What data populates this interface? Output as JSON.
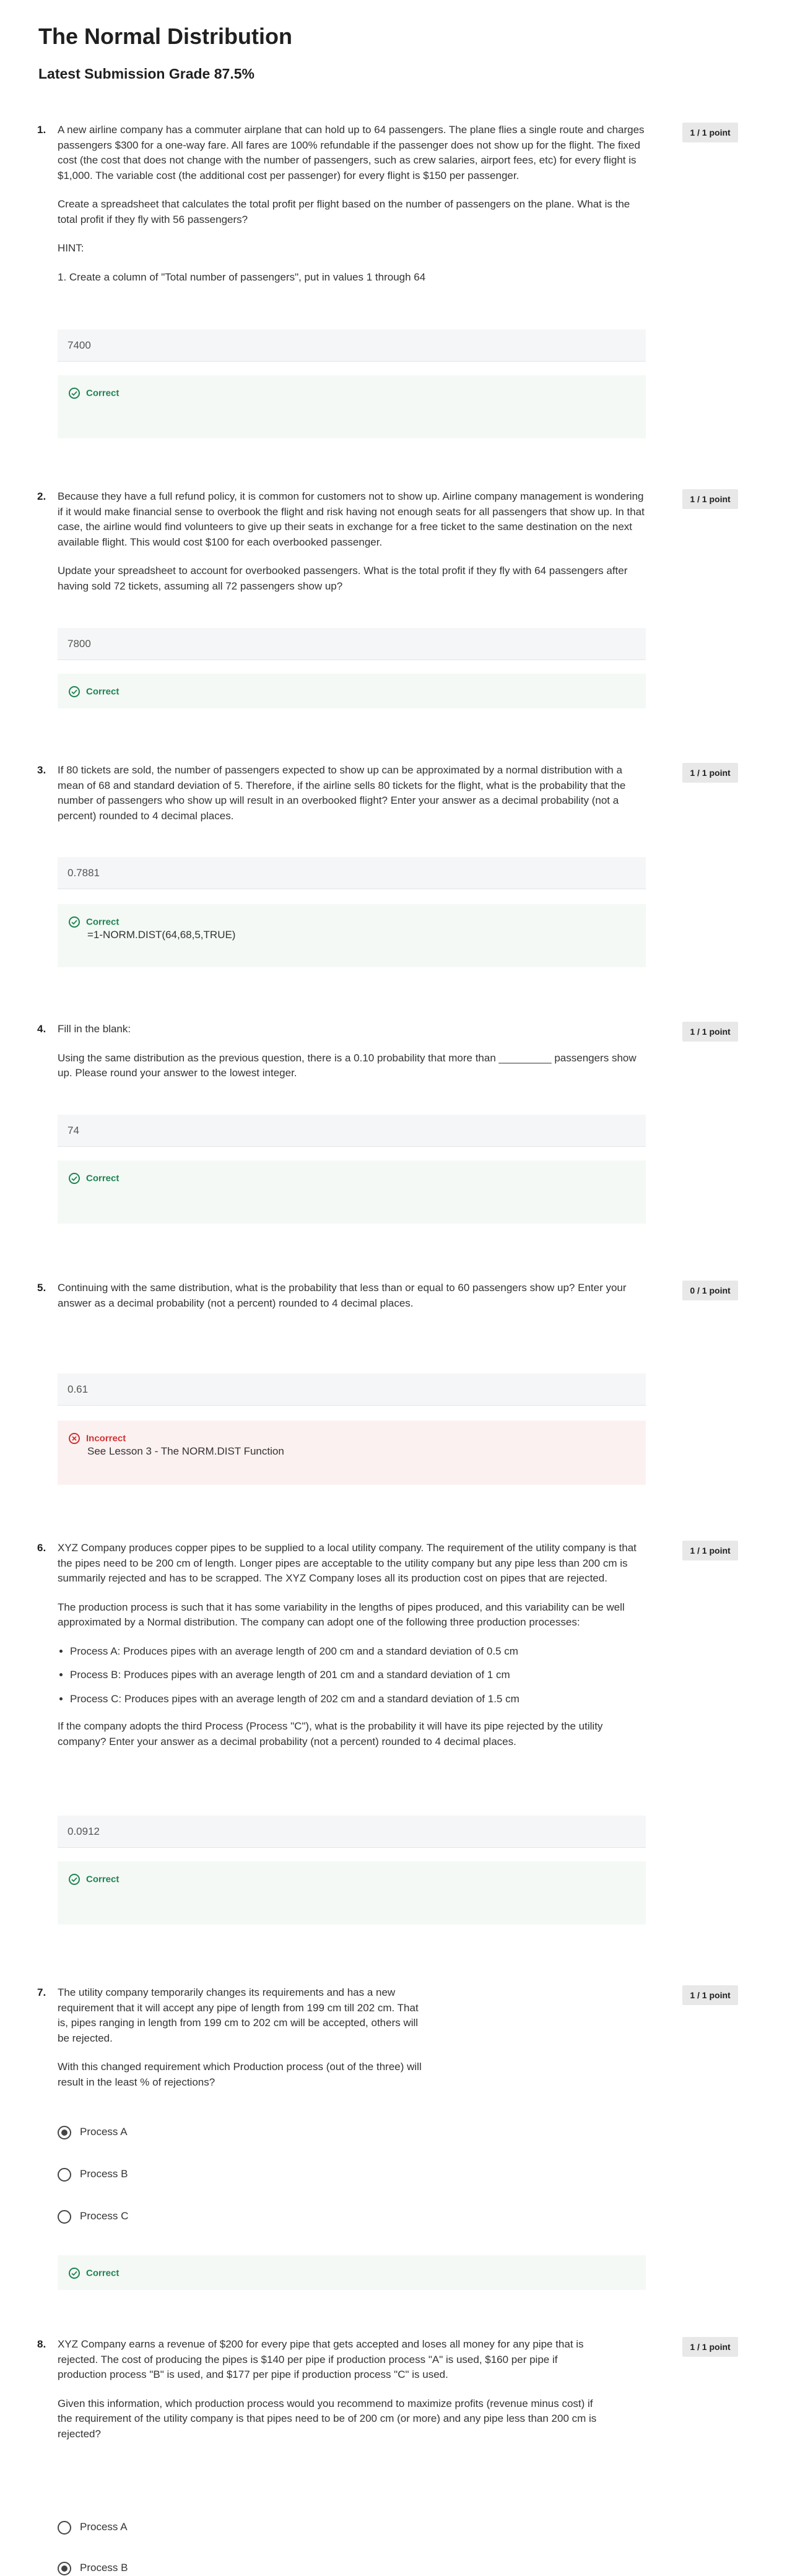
{
  "header": {
    "title": "The Normal Distribution",
    "grade": "Latest Submission Grade 87.5%"
  },
  "questions": [
    {
      "number": "1.",
      "points": "1 / 1 point",
      "paragraphs": [
        "A new airline company has a commuter airplane that can hold up to 64 passengers.  The plane flies a single route and charges passengers $300 for a one-way fare.  All fares are 100% refundable if the passenger does not show up for the flight. The fixed cost (the cost that does not change with the number of passengers, such as crew salaries, airport fees, etc) for every flight is $1,000. The variable cost (the additional cost per passenger) for every flight is $150 per passenger.",
        "Create a spreadsheet that calculates the total profit per flight based on the number of passengers on the plane. What is the total profit if they fly with 56 passengers?",
        "HINT:",
        "1. Create a column of \"Total number of passengers\", put in values 1 through 64"
      ],
      "answer": "7400",
      "feedback": "Correct",
      "note": ""
    },
    {
      "number": "2.",
      "points": "1 / 1 point",
      "paragraphs": [
        "Because they have a full refund policy, it is common for customers not to show up.  Airline company management is wondering if it would make financial sense to overbook the flight and risk having not enough seats for all passengers that show up.  In that case, the airline would find volunteers to give up their seats in exchange for a free ticket to the same destination on the next available flight.  This would cost $100 for each overbooked passenger.",
        "Update your spreadsheet to account for overbooked passengers.  What is the total profit if they fly with 64 passengers after having sold 72 tickets, assuming all 72 passengers show up?"
      ],
      "answer": "7800",
      "feedback": "Correct",
      "note": ""
    },
    {
      "number": "3.",
      "points": "1 / 1 point",
      "paragraphs": [
        "If 80 tickets are sold, the number of passengers expected to show up can be approximated by a normal distribution with a mean of 68 and standard deviation of 5.  Therefore, if the airline sells 80 tickets for the flight, what is the probability that the number of passengers who show up will result in an overbooked flight?  Enter your answer as a decimal probability (not a percent) rounded to 4 decimal places."
      ],
      "answer": "0.7881",
      "feedback": "Correct",
      "note": "=1-NORM.DIST(64,68,5,TRUE)"
    },
    {
      "number": "4.",
      "points": "1 / 1 point",
      "paragraphs": [
        "Fill in the blank:",
        "Using the same distribution as the previous question, there is a 0.10 probability that more than _________ passengers show up. Please round your answer to the lowest integer."
      ],
      "answer": "74",
      "feedback": "Correct",
      "note": ""
    },
    {
      "number": "5.",
      "points": "0 / 1 point",
      "paragraphs": [
        "Continuing with the same distribution, what is the probability that less than or equal to 60 passengers show up? Enter your answer as a decimal probability (not a percent) rounded to 4 decimal places."
      ],
      "answer": "0.61",
      "feedback": "Incorrect",
      "note": "See Lesson 3 - The NORM.DIST Function"
    },
    {
      "number": "6.",
      "points": "1 / 1 point",
      "paragraphs": [
        "XYZ Company produces copper pipes to be supplied to a local utility company. The requirement of the utility company is that the pipes need to be 200 cm of length.  Longer pipes are acceptable to the utility company but any pipe less than 200 cm is summarily rejected and has to be scrapped. The XYZ Company loses all its production cost on pipes that are rejected.",
        "The production process is such that it has some variability in the lengths of pipes produced, and this variability can be well approximated by a Normal distribution. The company can adopt one of the following three production processes:"
      ],
      "bullets": [
        "Process A: Produces pipes with an average length of 200 cm and a standard deviation of 0.5 cm",
        "Process B: Produces pipes with an average length of 201 cm and a standard deviation of 1 cm",
        "Process C: Produces pipes with an average length of 202 cm and a standard deviation of 1.5 cm"
      ],
      "after": "If the company adopts the third Process (Process \"C\"), what is the probability it will have its pipe rejected by the utility company? Enter your answer as a decimal probability (not a percent) rounded to 4 decimal places.",
      "answer": "0.0912",
      "feedback": "Correct",
      "note": ""
    },
    {
      "number": "7.",
      "points": "1 / 1 point",
      "paragraphs": [
        "The utility company temporarily changes its requirements and has a new requirement that it will accept any pipe of length from 199 cm till 202 cm. That is, pipes ranging in length from 199 cm to 202 cm will be accepted, others will be rejected.",
        "With this changed requirement which Production process (out of the three) will result in the least % of rejections?"
      ],
      "options": [
        "Process A",
        "Process B",
        "Process C"
      ],
      "selected": "Process A",
      "feedback": "Correct"
    },
    {
      "number": "8.",
      "points": "1 / 1 point",
      "paragraphs": [
        "XYZ Company earns a revenue of $200 for every pipe that gets accepted and loses all money for any pipe that is rejected. The cost of producing the pipes is $140 per pipe if production process \"A\" is used, $160 per pipe if production process \"B\" is used, and $177 per pipe if production process \"C\" is used.",
        "Given this information, which production process would you recommend to maximize profits (revenue minus cost) if the requirement of the utility company is that pipes need to be of 200 cm (or more) and any pipe less than 200 cm is rejected?"
      ],
      "options": [
        "Process A",
        "Process B"
      ],
      "selected": "Process B"
    }
  ],
  "colors": {
    "correct": "#1f8354",
    "incorrect": "#d03232",
    "correct_bg": "#f4f9f5",
    "incorrect_bg": "#fcf1f1",
    "points_bg": "#e8e8e8",
    "answer_bg": "#f5f6f7"
  },
  "icons": {
    "correct": "check-circle-icon",
    "incorrect": "x-circle-icon"
  }
}
